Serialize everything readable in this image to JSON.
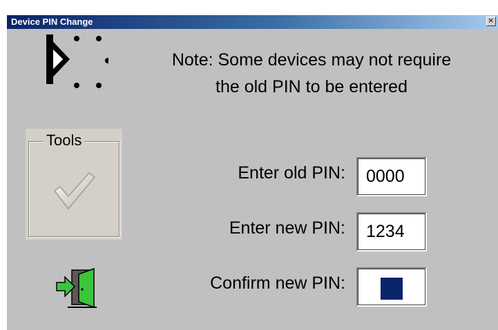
{
  "window": {
    "title": "Device PIN Change",
    "close_glyph": "×"
  },
  "note": {
    "line1": "Note: Some devices may not require",
    "line2": "the old PIN to be entered"
  },
  "tools": {
    "label": "Tools",
    "icon": "checkmark-icon"
  },
  "fields": {
    "old_pin_label": "Enter old PIN:",
    "old_pin_value": "0000",
    "new_pin_label": "Enter new PIN:",
    "new_pin_value": "1234",
    "confirm_pin_label": "Confirm new PIN:",
    "confirm_pin_value": ""
  },
  "icons": {
    "bluetooth": "bluetooth-icon",
    "exit": "exit-door-icon"
  },
  "colors": {
    "title_bar": "#0a246a",
    "background": "#c0c0c0",
    "selection": "#0a246a",
    "exit_icon": "#3cc43c"
  }
}
